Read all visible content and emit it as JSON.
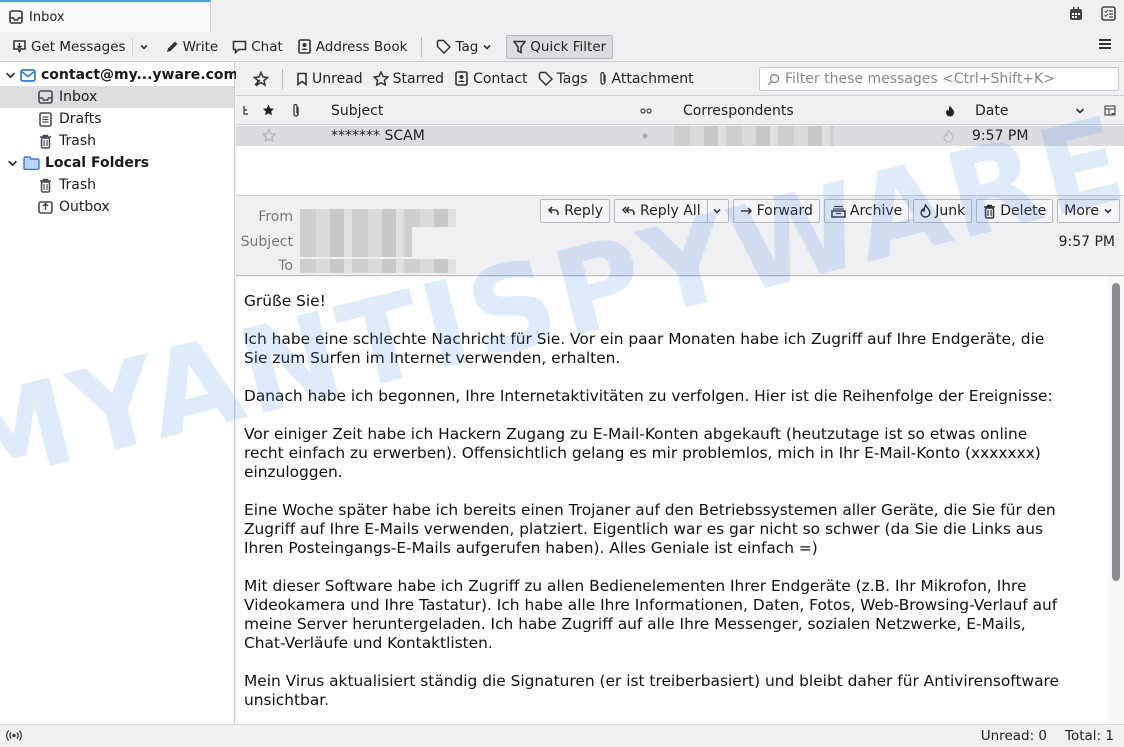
{
  "tab": {
    "title": "Inbox",
    "icon": "inbox-icon"
  },
  "tab_icons": [
    {
      "name": "calendar-icon"
    },
    {
      "name": "tasks-icon"
    }
  ],
  "toolbar": {
    "get_messages": "Get Messages",
    "write": "Write",
    "chat": "Chat",
    "address_book": "Address Book",
    "tag": "Tag",
    "quick_filter": "Quick Filter",
    "quick_filter_active": true
  },
  "folders": {
    "account": "contact@my...yware.com",
    "account_items": [
      {
        "label": "Inbox",
        "icon": "inbox-icon",
        "selected": true
      },
      {
        "label": "Drafts",
        "icon": "drafts-icon",
        "selected": false
      },
      {
        "label": "Trash",
        "icon": "trash-icon",
        "selected": false
      }
    ],
    "local": "Local Folders",
    "local_items": [
      {
        "label": "Trash",
        "icon": "trash-icon"
      },
      {
        "label": "Outbox",
        "icon": "outbox-icon"
      }
    ]
  },
  "quick_filter": {
    "unread": "Unread",
    "starred": "Starred",
    "contact": "Contact",
    "tags": "Tags",
    "attachment": "Attachment",
    "search_placeholder": "Filter these messages <Ctrl+Shift+K>"
  },
  "thread_columns": {
    "subject": "Subject",
    "correspondents": "Correspondents",
    "date": "Date"
  },
  "messages": [
    {
      "subject": "******* SCAM",
      "correspondent": "[redacted]",
      "date": "9:57 PM",
      "starred": false,
      "read": true
    }
  ],
  "message_header": {
    "from_label": "From",
    "subject_label": "Subject",
    "to_label": "To",
    "date": "9:57 PM"
  },
  "actions": {
    "reply": "Reply",
    "reply_all": "Reply All",
    "forward": "Forward",
    "archive": "Archive",
    "junk": "Junk",
    "delete": "Delete",
    "more": "More"
  },
  "body": {
    "paragraphs": [
      "Grüße Sie!",
      "Ich habe eine schlechte Nachricht für Sie. Vor ein paar Monaten habe ich Zugriff auf Ihre Endgeräte, die\nSie zum Surfen im Internet verwenden, erhalten.",
      "Danach habe ich begonnen, Ihre Internetaktivitäten zu verfolgen. Hier ist die Reihenfolge der Ereignisse:",
      "Vor einiger Zeit habe ich Hackern Zugang zu E-Mail-Konten abgekauft (heutzutage ist so etwas online\nrecht einfach zu erwerben). Offensichtlich gelang es mir problemlos, mich in Ihr E-Mail-Konto (xxxxxxx)\neinzuloggen.",
      "Eine Woche später habe ich bereits einen Trojaner auf den Betriebssystemen aller Geräte, die Sie für den\nZugriff auf Ihre E-Mails verwenden, platziert. Eigentlich war es gar nicht so schwer (da Sie die Links aus\nIhren Posteingangs-E-Mails aufgerufen haben). Alles Geniale ist einfach =)",
      "Mit dieser Software habe ich Zugriff zu allen Bedienelementen Ihrer Endgeräte (z.B. Ihr Mikrofon, Ihre\nVideokamera und Ihre Tastatur). Ich habe alle Ihre Informationen, Daten, Fotos, Web-Browsing-Verlauf auf\nmeine Server heruntergeladen. Ich habe Zugriff auf alle Ihre Messenger, sozialen Netzwerke, E-Mails,\nChat-Verläufe und Kontaktlisten.",
      "Mein Virus aktualisiert ständig die Signaturen (er ist treiberbasiert) und bleibt daher für Antivirensoftware\nunsichtbar."
    ]
  },
  "watermark": "MYANTISPYWARE.COM",
  "status": {
    "unread": "Unread: 0",
    "total": "Total: 1"
  }
}
